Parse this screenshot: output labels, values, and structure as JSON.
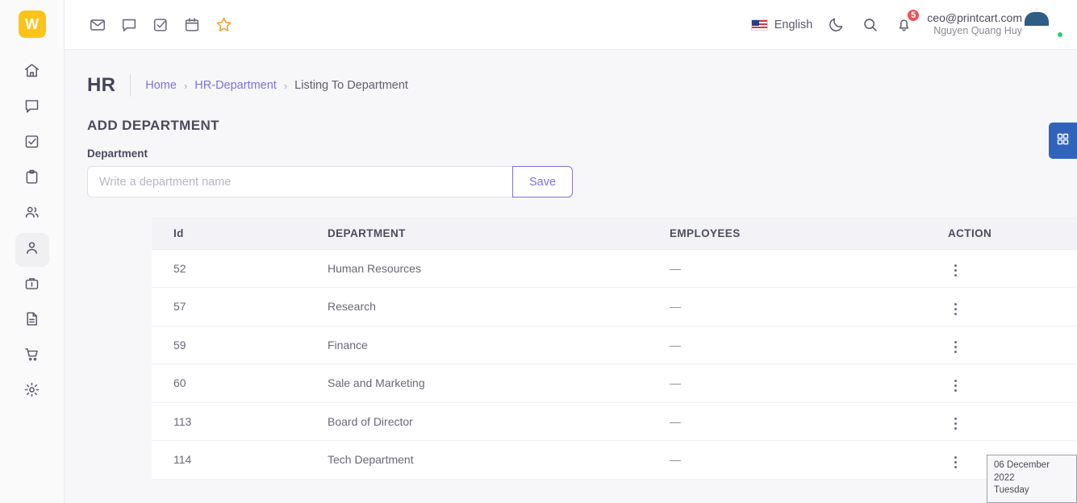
{
  "brand": {
    "logo_text": "W",
    "logo_color": "#fcc419"
  },
  "sidebar": {
    "items": [
      {
        "name": "home",
        "icon": "home-icon",
        "active": false
      },
      {
        "name": "chat",
        "icon": "chat-icon",
        "active": false
      },
      {
        "name": "tasks",
        "icon": "check-square-icon",
        "active": false
      },
      {
        "name": "clipboard",
        "icon": "clipboard-icon",
        "active": false
      },
      {
        "name": "users",
        "icon": "users-icon",
        "active": false
      },
      {
        "name": "profile",
        "icon": "person-icon",
        "active": true
      },
      {
        "name": "briefcase",
        "icon": "briefcase-icon",
        "active": false
      },
      {
        "name": "documents",
        "icon": "document-icon",
        "active": false
      },
      {
        "name": "cart",
        "icon": "cart-icon",
        "active": false
      },
      {
        "name": "settings",
        "icon": "gear-icon",
        "active": false
      }
    ]
  },
  "topbar": {
    "quick_icons": [
      {
        "name": "mail-icon"
      },
      {
        "name": "chat-icon"
      },
      {
        "name": "check-square-icon"
      },
      {
        "name": "calendar-icon"
      },
      {
        "name": "star-icon"
      }
    ],
    "language": "English",
    "language_flag": "us-flag-icon",
    "theme_icon": "moon-icon",
    "search_icon": "search-icon",
    "notifications_icon": "bell-icon",
    "notifications_count": "5",
    "user_email": "ceo@printcart.com",
    "user_name": "Nguyen Quang Huy",
    "status": "online"
  },
  "page": {
    "title": "HR",
    "breadcrumb": [
      {
        "label": "Home",
        "link": true
      },
      {
        "label": "HR-Department",
        "link": true
      },
      {
        "label": "Listing To Department",
        "link": false
      }
    ],
    "breadcrumb_separator": "›",
    "section_title": "ADD DEPARTMENT"
  },
  "form": {
    "label": "Department",
    "placeholder": "Write a department name",
    "value": "",
    "save_label": "Save"
  },
  "table": {
    "columns": [
      "Id",
      "DEPARTMENT",
      "EMPLOYEES",
      "ACTION"
    ],
    "rows": [
      {
        "id": "52",
        "department": "Human Resources",
        "employees": "—"
      },
      {
        "id": "57",
        "department": "Research",
        "employees": "—"
      },
      {
        "id": "59",
        "department": "Finance",
        "employees": "—"
      },
      {
        "id": "60",
        "department": "Sale and Marketing",
        "employees": "—"
      },
      {
        "id": "113",
        "department": "Board of Director",
        "employees": "—"
      },
      {
        "id": "114",
        "department": "Tech Department",
        "employees": "—"
      }
    ]
  },
  "widgets": {
    "grid_button_icon": "grid-icon",
    "grid_button_color": "#3064ba",
    "date": "06 December 2022",
    "weekday": "Tuesday"
  },
  "colors": {
    "accent": "#7b72e0",
    "badge": "#ee5253",
    "star": "#f59f3d"
  }
}
